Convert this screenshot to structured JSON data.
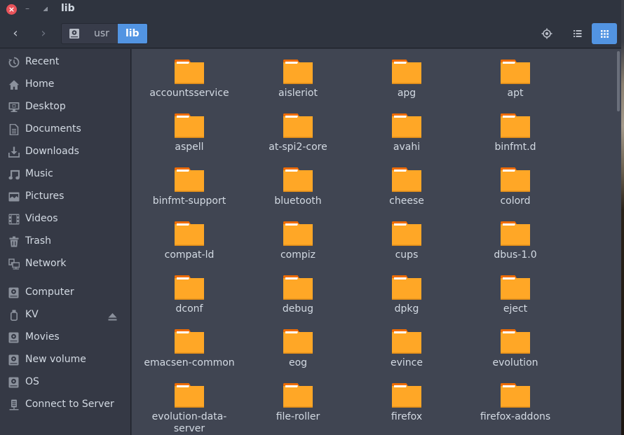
{
  "window": {
    "title": "lib",
    "controls": {
      "close": "×",
      "minimize": "–"
    }
  },
  "header": {
    "back_icon": "‹",
    "forward_icon": "›",
    "path": [
      {
        "label": "",
        "icon": "drive-icon"
      },
      {
        "label": "usr"
      },
      {
        "label": "lib",
        "active": true
      }
    ],
    "actions": [
      "locate-icon",
      "list-view-icon",
      "grid-view-icon"
    ],
    "active_view": "grid"
  },
  "sidebar": {
    "items": [
      {
        "label": "Recent",
        "icon": "clock-icon"
      },
      {
        "label": "Home",
        "icon": "home-icon"
      },
      {
        "label": "Desktop",
        "icon": "desktop-icon"
      },
      {
        "label": "Documents",
        "icon": "document-icon"
      },
      {
        "label": "Downloads",
        "icon": "download-icon"
      },
      {
        "label": "Music",
        "icon": "music-icon"
      },
      {
        "label": "Pictures",
        "icon": "picture-icon"
      },
      {
        "label": "Videos",
        "icon": "video-icon"
      },
      {
        "label": "Trash",
        "icon": "trash-icon"
      },
      {
        "label": "Network",
        "icon": "network-icon"
      }
    ],
    "devices": [
      {
        "label": "Computer",
        "icon": "drive-icon"
      },
      {
        "label": "KV",
        "icon": "usb-icon",
        "ejectable": true
      },
      {
        "label": "Movies",
        "icon": "drive-icon"
      },
      {
        "label": "New volume",
        "icon": "drive-icon"
      },
      {
        "label": "OS",
        "icon": "drive-icon"
      },
      {
        "label": "Connect to Server",
        "icon": "server-icon"
      }
    ]
  },
  "files": [
    "accountsservice",
    "aisleriot",
    "apg",
    "apt",
    "aspell",
    "at-spi2-core",
    "avahi",
    "binfmt.d",
    "binfmt-support",
    "bluetooth",
    "cheese",
    "colord",
    "compat-ld",
    "compiz",
    "cups",
    "dbus-1.0",
    "dconf",
    "debug",
    "dpkg",
    "eject",
    "emacsen-common",
    "eog",
    "evince",
    "evolution",
    "evolution-data-server",
    "file-roller",
    "firefox",
    "firefox-addons"
  ],
  "file_label_lines": {
    "evolution-data-server": [
      "evolution-data-",
      "server"
    ]
  },
  "colors": {
    "accent": "#5294e2",
    "folder_body": "#ffa726",
    "folder_tab": "#ef6c00",
    "close_button": "#e8535a"
  }
}
